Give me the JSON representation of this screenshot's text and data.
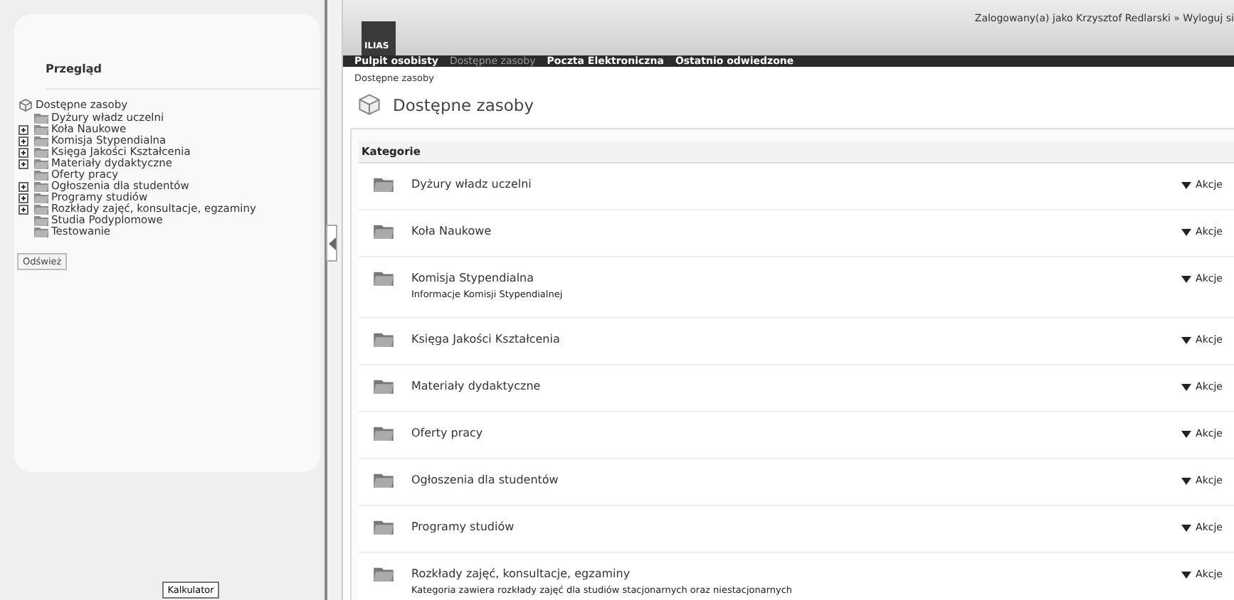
{
  "sidebar": {
    "title": "Przegląd",
    "tree": {
      "label": "Dostępne zasoby",
      "children": [
        {
          "label": "Dyżury władz uczelni",
          "kind": "leaf"
        },
        {
          "label": "Koła Naukowe",
          "kind": "collapsed"
        },
        {
          "label": "Komisja Stypendialna",
          "kind": "collapsed"
        },
        {
          "label": "Księga Jakości Kształcenia",
          "kind": "collapsed"
        },
        {
          "label": "Materiały dydaktyczne",
          "kind": "collapsed"
        },
        {
          "label": "Oferty pracy",
          "kind": "leaf"
        },
        {
          "label": "Ogłoszenia dla studentów",
          "kind": "collapsed"
        },
        {
          "label": "Programy studiów",
          "kind": "collapsed"
        },
        {
          "label": "Rozkłady zajęć, konsultacje, egzaminy",
          "kind": "collapsed"
        },
        {
          "label": "Studia Podyplomowe",
          "kind": "leaf"
        },
        {
          "label": "Testowanie",
          "kind": "leaf"
        }
      ]
    },
    "refresh_button": "Odśwież",
    "bottom_button": "Kalkulator"
  },
  "header": {
    "logo": "ILIAS",
    "user_info": "Zalogowany(a) jako Krzysztof Redlarski » Wyloguj si"
  },
  "nav": [
    {
      "label": "Pulpit osobisty",
      "selected": false
    },
    {
      "label": "Dostępne zasoby",
      "selected": true
    },
    {
      "label": "Poczta Elektroniczna",
      "selected": false
    },
    {
      "label": "Ostatnio odwiedzone",
      "selected": false
    }
  ],
  "breadcrumb": "Dostępne zasoby",
  "page_title": "Dostępne zasoby",
  "section_title": "Kategorie",
  "categories": [
    {
      "title": "Dyżury władz uczelni",
      "action": "Akcje"
    },
    {
      "title": "Koła Naukowe",
      "action": "Akcje"
    },
    {
      "title": "Komisja Stypendialna",
      "description": "Informacje Komisji Stypendialnej",
      "action": "Akcje"
    },
    {
      "title": "Księga Jakości Kształcenia",
      "action": "Akcje"
    },
    {
      "title": "Materiały dydaktyczne",
      "action": "Akcje"
    },
    {
      "title": "Oferty pracy",
      "action": "Akcje"
    },
    {
      "title": "Ogłoszenia dla studentów",
      "action": "Akcje"
    },
    {
      "title": "Programy studiów",
      "action": "Akcje"
    },
    {
      "title": "Rozkłady zajęć, konsultacje, egzaminy",
      "description": "Kategoria zawiera rozkłady zajęć dla studiów stacjonarnych oraz niestacjonarnych",
      "action": "Akcje"
    }
  ]
}
